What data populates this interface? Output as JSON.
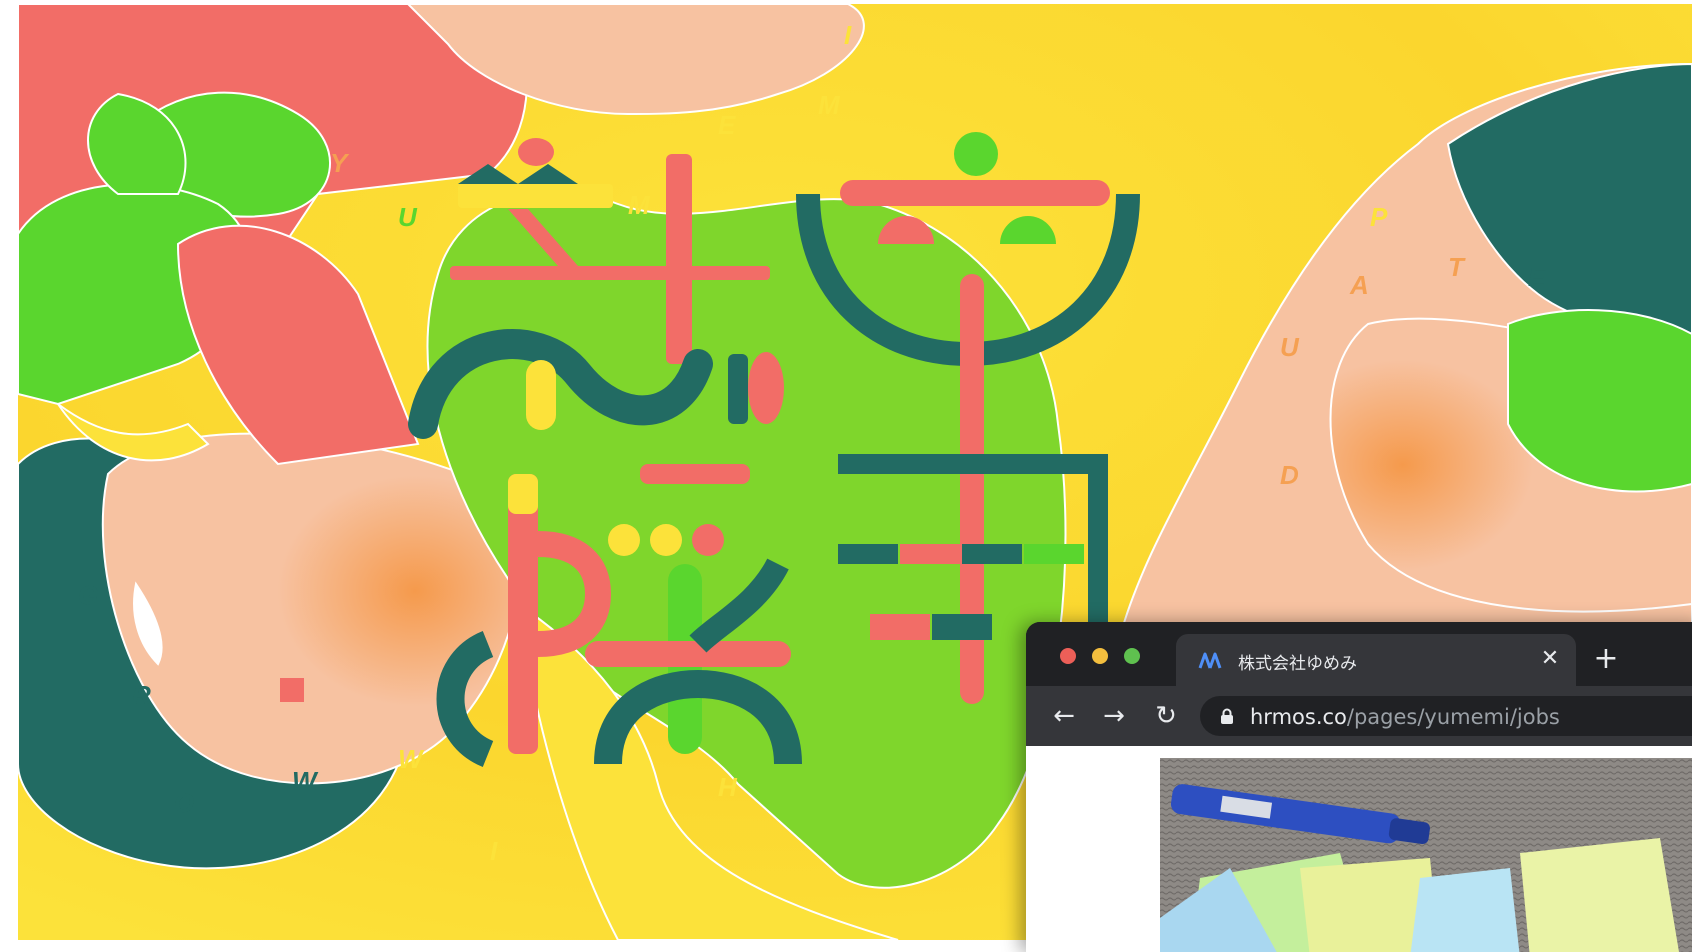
{
  "artwork": {
    "headline_glyphs": [
      "新",
      "卒",
      "採",
      "用"
    ],
    "scatter_letters": [
      "Y",
      "U",
      "M",
      "E",
      "M",
      "I",
      "U",
      "P",
      "D",
      "A",
      "T",
      "E",
      "G",
      "R",
      "O",
      "W",
      "W",
      "I",
      "T",
      "H"
    ],
    "colors": {
      "yellow": "#fce23a",
      "salmon": "#f26d67",
      "green": "#5ad62e",
      "teal": "#226b63",
      "peach": "#f7c2a1",
      "orange": "#f5a052"
    }
  },
  "browser": {
    "tab_title": "株式会社ゆめみ",
    "tab_logo_icon": "yumemi-logo-icon",
    "close_symbol": "✕",
    "new_tab_symbol": "+",
    "back_symbol": "←",
    "forward_symbol": "→",
    "reload_symbol": "↻",
    "url_host": "hrmos.co",
    "url_path": "/pages/yumemi/jobs",
    "colors": {
      "titlebar": "#202124",
      "toolbar": "#35363a",
      "close_dot": "#ec5f58",
      "minimize_dot": "#f3be3e",
      "zoom_dot": "#5fc14f"
    }
  },
  "page_content": {
    "hero_image": "sticky-notes-and-marker-photo"
  }
}
